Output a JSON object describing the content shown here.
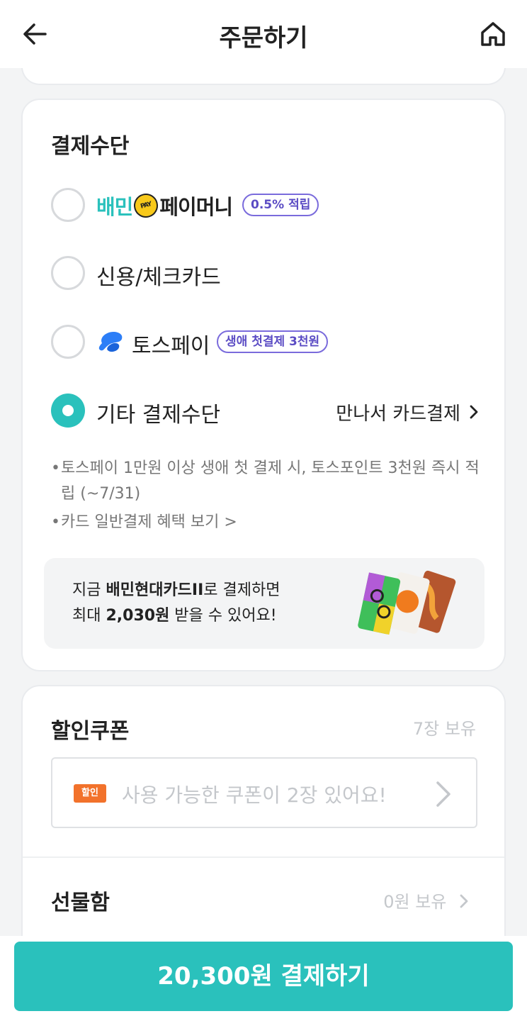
{
  "header": {
    "title": "주문하기"
  },
  "payment": {
    "section_title": "결제수단",
    "options": [
      {
        "logo_part1": "배민",
        "logo_coin": "PAY",
        "logo_part2": "페이머니",
        "badge": "0.5% 적립",
        "selected": false
      },
      {
        "label": "신용/체크카드",
        "selected": false
      },
      {
        "label": "토스페이",
        "badge": "생애 첫결제 3천원",
        "selected": false
      },
      {
        "label": "기타 결제수단",
        "right_text": "만나서 카드결제",
        "selected": true
      }
    ],
    "notes": [
      "토스페이 1만원 이상 생애 첫 결제 시, 토스포인트 3천원 즉시 적립 (~7/31)",
      "카드 일반결제 혜택 보기 >"
    ],
    "promo": {
      "line1_prefix": "지금 ",
      "line1_bold": "배민현대카드II",
      "line1_suffix": "로 결제하면",
      "line2_prefix": "최대 ",
      "line2_bold": "2,030원",
      "line2_suffix": " 받을 수 있어요!"
    }
  },
  "coupon": {
    "section_title": "할인쿠폰",
    "count": "7장 보유",
    "tag": "할인",
    "placeholder": "사용 가능한 쿠폰이 2장 있어요!"
  },
  "gift": {
    "section_title": "선물함",
    "balance": "0원 보유"
  },
  "pay_button": {
    "label": "20,300원 결제하기"
  },
  "colors": {
    "accent": "#2ac1bc",
    "badge": "#5b4cc4",
    "coupon_tag": "#f2722b"
  }
}
